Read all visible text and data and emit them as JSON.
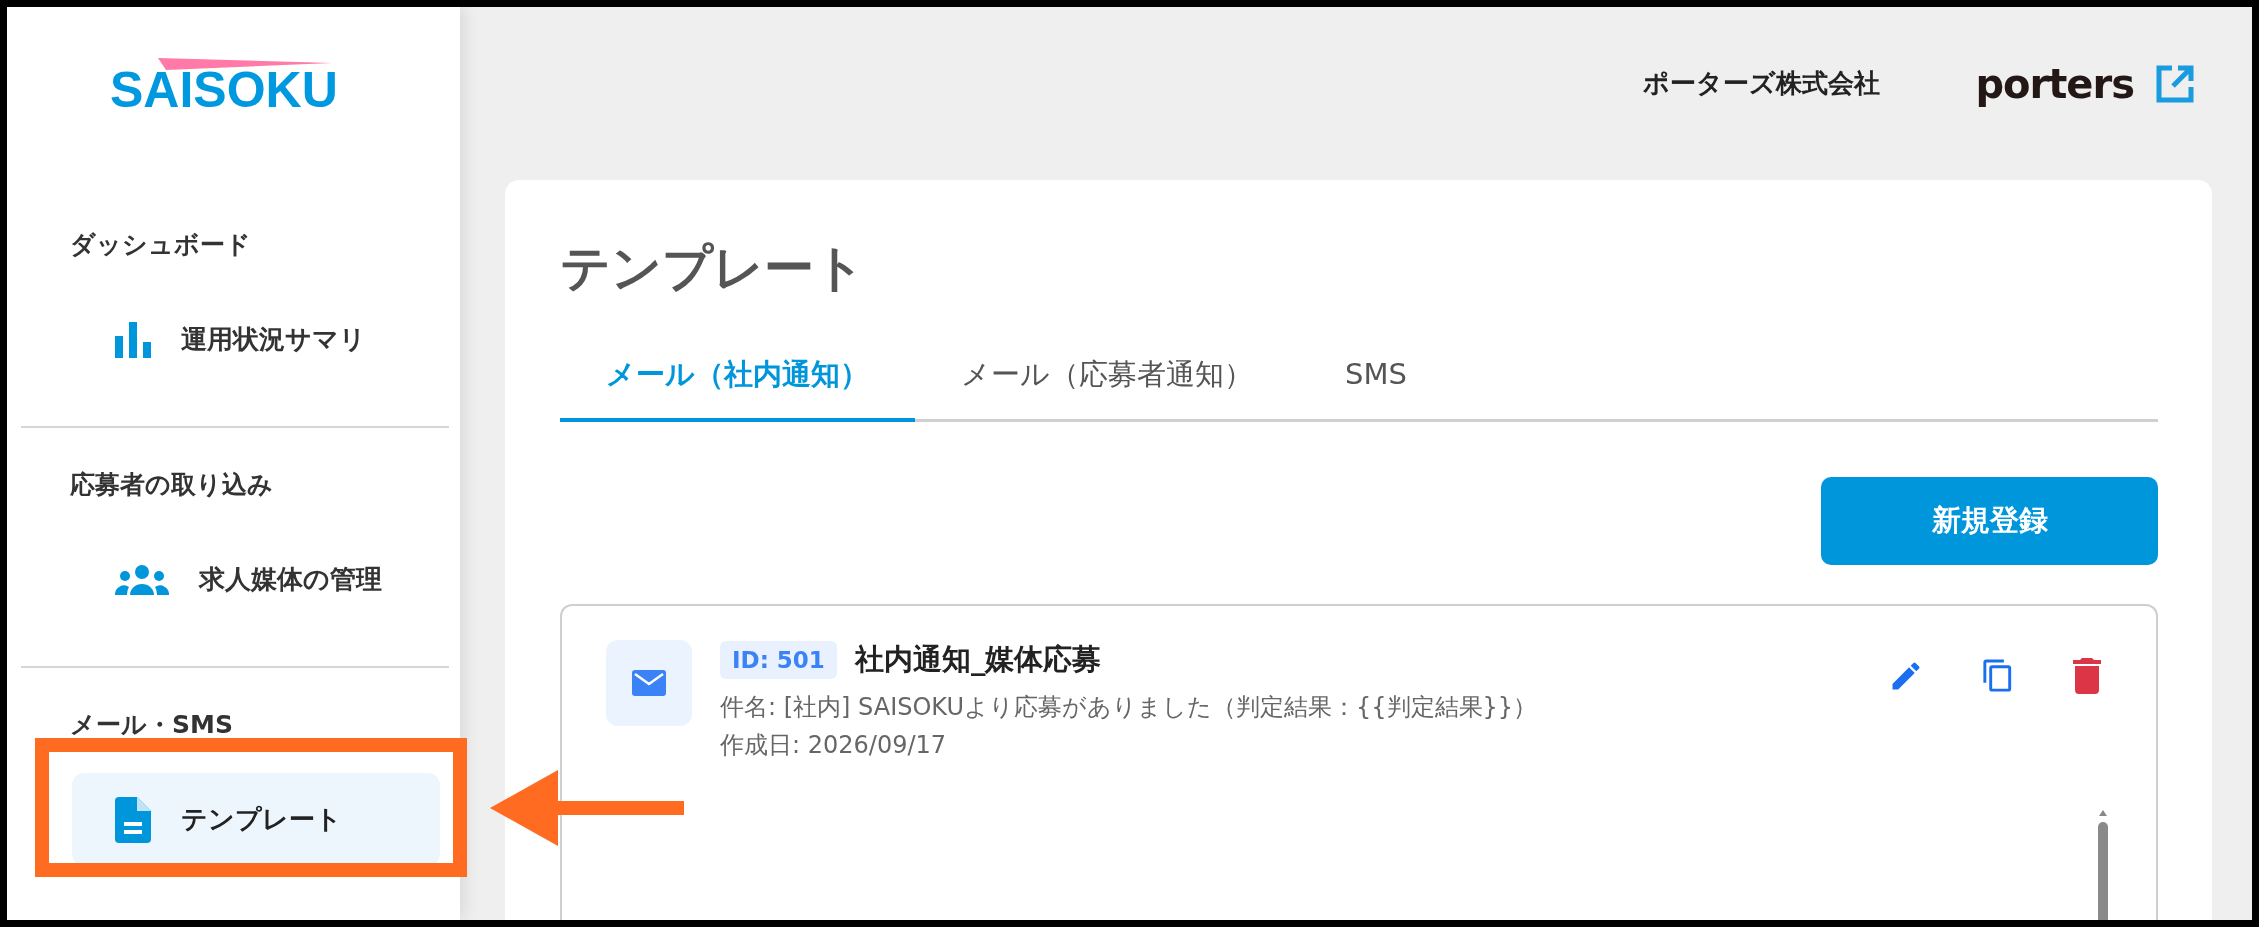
{
  "logo": {
    "text": "SAISOKU"
  },
  "sidebar": {
    "sections": [
      {
        "heading": "ダッシュボード",
        "items": [
          {
            "label": "運用状況サマリ",
            "kind": "chart",
            "selected": false
          }
        ]
      },
      {
        "heading": "応募者の取り込み",
        "items": [
          {
            "label": "求人媒体の管理",
            "kind": "people",
            "selected": false
          }
        ]
      },
      {
        "heading": "メール・SMS",
        "items": [
          {
            "label": "テンプレート",
            "kind": "document",
            "selected": true
          }
        ]
      }
    ]
  },
  "header": {
    "company": "ポーターズ株式会社",
    "brand": "porters"
  },
  "page": {
    "title": "テンプレート",
    "tabs": [
      {
        "label": "メール（社内通知）",
        "selected": true
      },
      {
        "label": "メール（応募者通知）",
        "selected": false
      },
      {
        "label": "SMS",
        "selected": false
      }
    ],
    "new_button": "新規登録",
    "templates": [
      {
        "id_badge": "ID: 501",
        "name": "社内通知_媒体応募",
        "subject": "件名: [社内] SAISOKUより応募がありました（判定結果：{{判定結果}}）",
        "created": "作成日: 2026/09/17"
      }
    ]
  }
}
